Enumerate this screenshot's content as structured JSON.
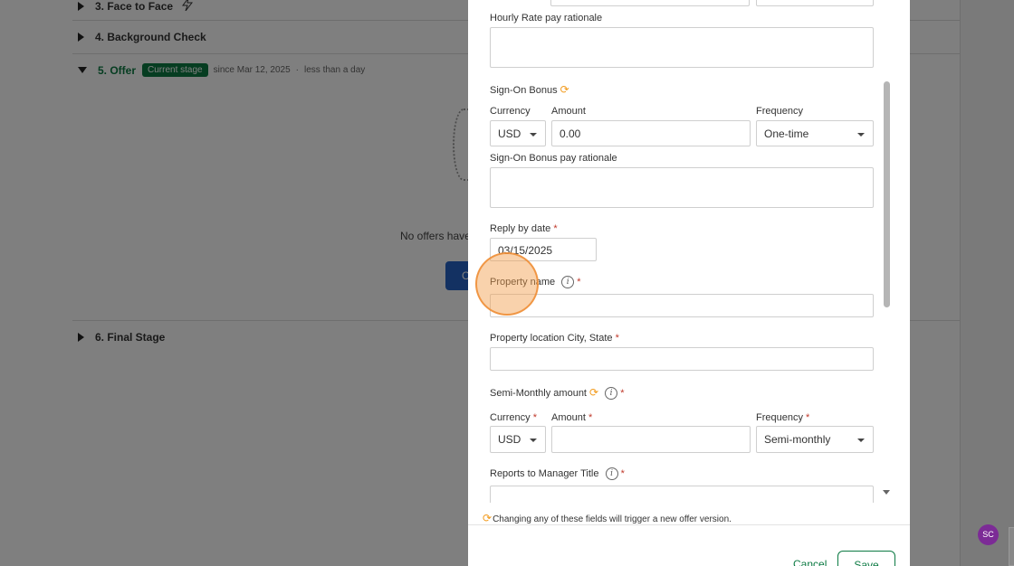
{
  "background": {
    "stages": [
      {
        "label": "3. Face to Face"
      },
      {
        "label": "4. Background Check"
      },
      {
        "label": "5. Offer",
        "badge": "Current stage",
        "since": "since Mar 12, 2025",
        "duration": "less than a day"
      },
      {
        "label": "6. Final Stage"
      }
    ],
    "empty_state": "No offers have",
    "create_button_label": "C"
  },
  "modal": {
    "hourly_rate_rationale_label": "Hourly Rate pay rationale",
    "sign_on_bonus": {
      "section_label": "Sign-On Bonus",
      "currency_label": "Currency",
      "currency_value": "USD",
      "amount_label": "Amount",
      "amount_value": "0.00",
      "frequency_label": "Frequency",
      "frequency_value": "One-time",
      "rationale_label": "Sign-On Bonus pay rationale"
    },
    "reply_by": {
      "label": "Reply by date",
      "required": "*",
      "value": "03/15/2025"
    },
    "property_name": {
      "label": "Property name",
      "info": "i",
      "required": "*",
      "value": ""
    },
    "property_location": {
      "label": "Property location City, State",
      "required": "*",
      "value": ""
    },
    "semi_monthly": {
      "section_label": "Semi-Monthly amount",
      "info": "i",
      "required": "*",
      "currency_label": "Currency",
      "currency_value": "USD",
      "amount_label": "Amount",
      "amount_value": "",
      "frequency_label": "Frequency",
      "frequency_value": "Semi-monthly"
    },
    "reports_to": {
      "label": "Reports to Manager Title",
      "info": "i",
      "required": "*"
    },
    "footer_note": "Changing any of these fields will trigger a new offer version.",
    "cancel_label": "Cancel",
    "save_label": "Save"
  },
  "user": {
    "initials": "SC"
  },
  "icons": {
    "sync": "sync-icon",
    "info": "info-icon",
    "bolt": "bolt-icon"
  },
  "colors": {
    "accent_green": "#0c7a43",
    "required_red": "#c0392b",
    "sync_orange": "#f29b1d",
    "avatar_purple": "#7c2b96"
  }
}
